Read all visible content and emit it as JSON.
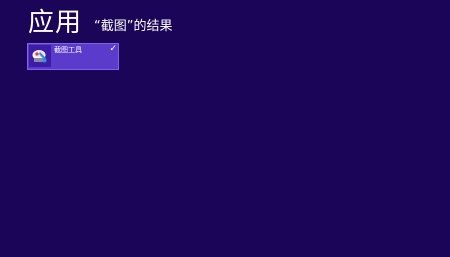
{
  "header": {
    "title": "应用",
    "results_label": "“截图”的结果"
  },
  "results": [
    {
      "label": "截图工具",
      "icon": "snipping-tool-icon",
      "checked": true,
      "check_glyph": "✓"
    }
  ],
  "colors": {
    "background": "#1b0558",
    "tile": "#5b3bcc",
    "tile_icon_background": "#3f1ca8",
    "text": "#ffffff"
  }
}
